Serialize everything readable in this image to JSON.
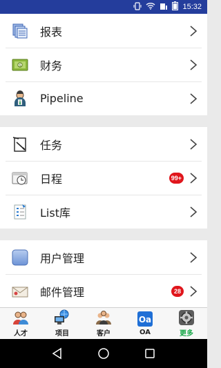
{
  "status_bar": {
    "time": "15:32"
  },
  "groups": [
    {
      "items": [
        {
          "label": "报表",
          "icon": "report-icon"
        },
        {
          "label": "财务",
          "icon": "finance-icon"
        },
        {
          "label": "Pipeline",
          "icon": "pipeline-icon"
        }
      ]
    },
    {
      "items": [
        {
          "label": "任务",
          "icon": "task-icon"
        },
        {
          "label": "日程",
          "icon": "schedule-icon",
          "badge": "99+"
        },
        {
          "label": "List库",
          "icon": "list-library-icon"
        }
      ]
    },
    {
      "items": [
        {
          "label": "用户管理",
          "icon": "user-management-icon"
        },
        {
          "label": "邮件管理",
          "icon": "mail-management-icon",
          "badge": "28"
        }
      ]
    }
  ],
  "tabs": [
    {
      "label": "人才",
      "icon": "talent-icon"
    },
    {
      "label": "项目",
      "icon": "project-icon"
    },
    {
      "label": "客户",
      "icon": "customer-icon"
    },
    {
      "label": "OA",
      "icon": "oa-icon"
    },
    {
      "label": "更多",
      "icon": "more-icon",
      "active": true
    }
  ],
  "colors": {
    "status_bar": "#243d9c",
    "badge": "#e0161c",
    "active_tab": "#1aa84a"
  }
}
